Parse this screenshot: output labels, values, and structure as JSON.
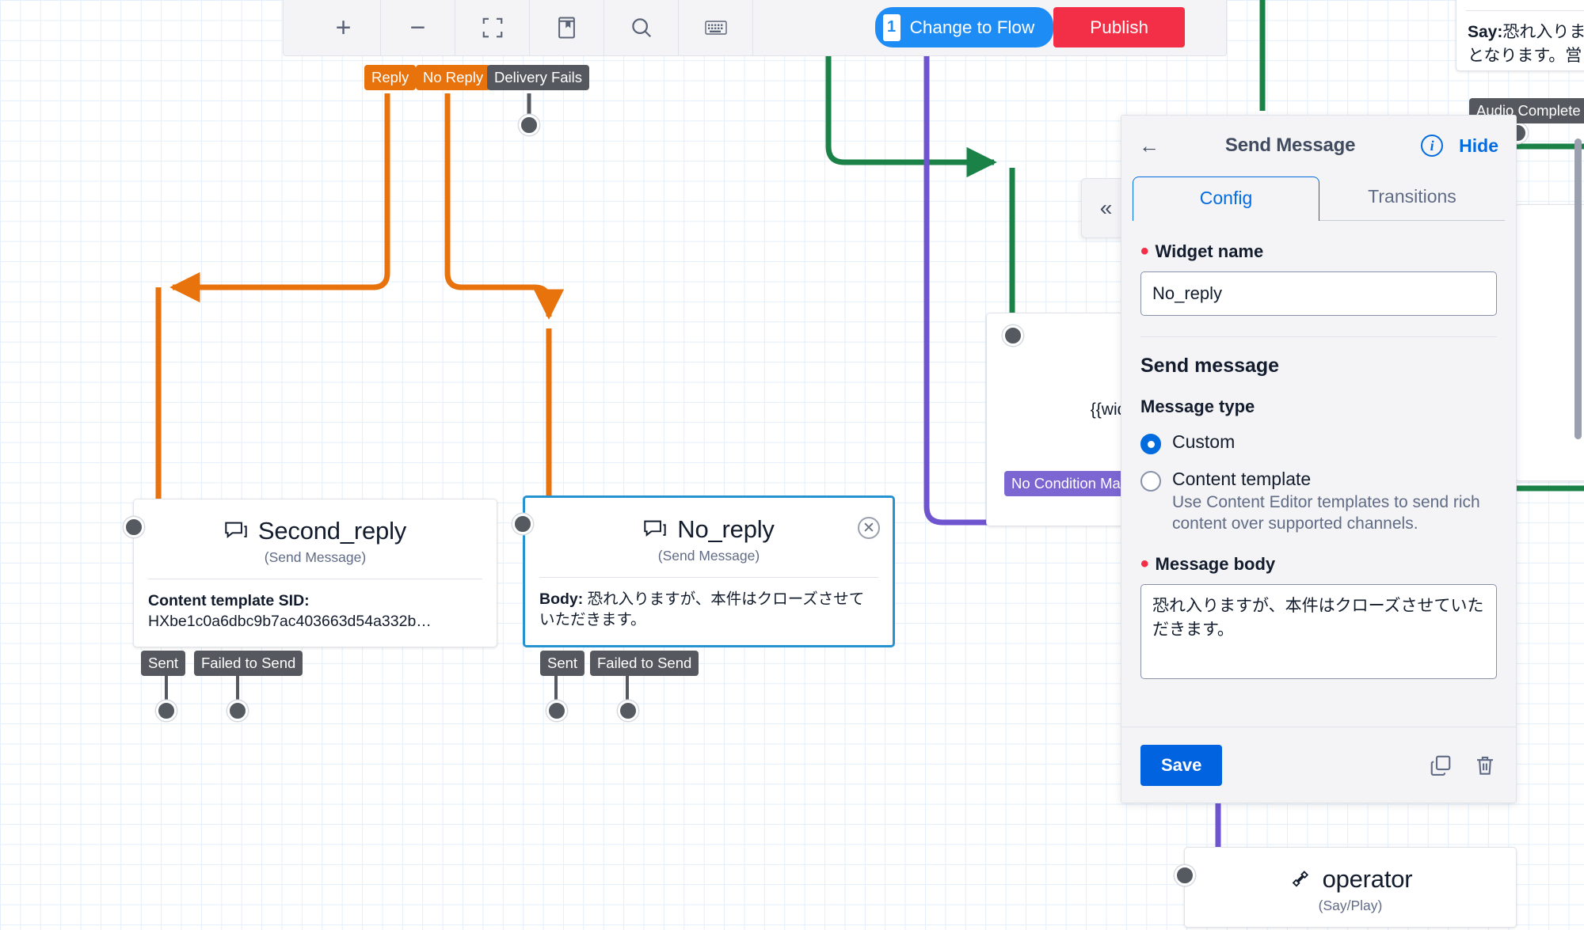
{
  "toolbar": {
    "buttons": [
      {
        "name": "zoom-in",
        "glyph": "+"
      },
      {
        "name": "zoom-out",
        "glyph": "−"
      },
      {
        "name": "fit-to-screen",
        "glyph": ""
      },
      {
        "name": "library",
        "glyph": ""
      },
      {
        "name": "search",
        "glyph": ""
      },
      {
        "name": "keyboard-shortcuts",
        "glyph": ""
      }
    ],
    "change_to_flow_label": "Change to Flow",
    "change_to_flow_count": "1",
    "publish_label": "Publish"
  },
  "collapse_handle": {
    "glyph": "«"
  },
  "panel": {
    "back_glyph": "←",
    "title": "Send Message",
    "info_glyph": "i",
    "hide_label": "Hide",
    "tabs": [
      {
        "label": "Config",
        "active": true
      },
      {
        "label": "Transitions",
        "active": false
      }
    ],
    "widget_name_label": "Widget name",
    "widget_name_value": "No_reply",
    "send_message_heading": "Send message",
    "message_type_label": "Message type",
    "options": [
      {
        "label": "Custom",
        "selected": true,
        "desc": ""
      },
      {
        "label": "Content template",
        "selected": false,
        "desc": "Use Content Editor templates to send rich content over supported channels."
      }
    ],
    "message_body_label": "Message body",
    "message_body_value": "恐れ入りますが、本件はクローズさせていただきます。",
    "save_label": "Save",
    "duplicate_icon": "duplicate-icon",
    "delete_icon": "trash-icon"
  },
  "nodes": {
    "second_reply": {
      "title": "Second_reply",
      "subtitle": "(Send Message)",
      "body_label": "Content template SID:",
      "body_value": "HXbe1c0a6dbc9b7ac403663d54a332b…",
      "transitions": [
        "Sent",
        "Failed to Send"
      ]
    },
    "no_reply": {
      "title": "No_reply",
      "subtitle": "(Send Message)",
      "body_label": "Body:",
      "body_value": "恐れ入りますが、本件はクローズさせていただきます。",
      "transitions": [
        "Sent",
        "Failed to Send"
      ],
      "close_glyph": "✕"
    },
    "operator": {
      "title": "operator",
      "subtitle": "(Say/Play)"
    },
    "say_card": {
      "body_label": "Say:",
      "body_line1": "恐れ入りま",
      "body_line2": "となります。営",
      "transition": "Audio Complete"
    },
    "split_card": {
      "expression": "{{widg",
      "transition": "No Condition Match"
    }
  },
  "top_transitions": [
    {
      "label": "Reply",
      "color": "orange"
    },
    {
      "label": "No Reply",
      "color": "orange"
    },
    {
      "label": "Delivery Fails",
      "color": "gray"
    }
  ],
  "colors": {
    "orange": "#e8720c",
    "green": "#1a8147",
    "purple": "#6f54cf",
    "blue": "#1e8cf5",
    "publish_red": "#f22f46",
    "save_blue": "#0263e0",
    "selected_border": "#2593d2"
  }
}
